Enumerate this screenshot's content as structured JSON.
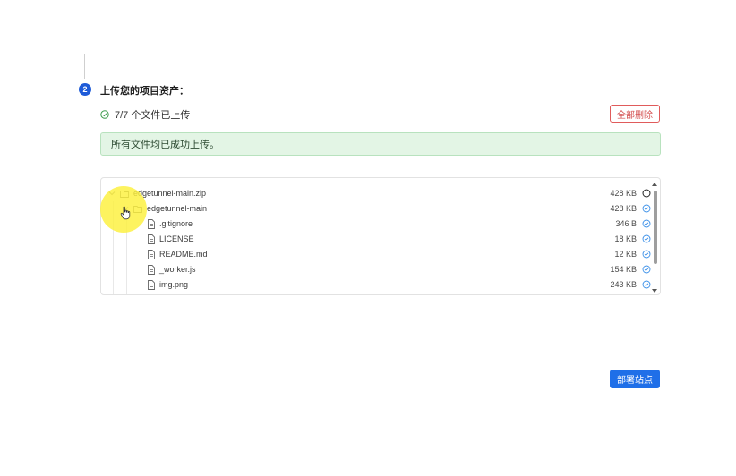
{
  "step": {
    "number": "2",
    "title": "上传您的项目资产："
  },
  "upload_status": {
    "text": "7/7 个文件已上传",
    "delete_all_label": "全部删除"
  },
  "success_banner": {
    "text": "所有文件均已成功上传。"
  },
  "file_tree": {
    "rows": [
      {
        "name": "edgetunnel-main.zip",
        "size": "428 KB",
        "type": "folder",
        "expanded": true,
        "status": "pending-circle"
      },
      {
        "name": "edgetunnel-main",
        "size": "428 KB",
        "type": "folder",
        "expanded": true,
        "status": "check-circle"
      },
      {
        "name": ".gitignore",
        "size": "346 B",
        "type": "file",
        "status": "check-circle"
      },
      {
        "name": "LICENSE",
        "size": "18 KB",
        "type": "file",
        "status": "check-circle"
      },
      {
        "name": "README.md",
        "size": "12 KB",
        "type": "file",
        "status": "check-circle"
      },
      {
        "name": "_worker.js",
        "size": "154 KB",
        "type": "file",
        "status": "check-circle"
      },
      {
        "name": "img.png",
        "size": "243 KB",
        "type": "file",
        "status": "check-circle"
      }
    ]
  },
  "deploy": {
    "label": "部署站点"
  },
  "colors": {
    "accent": "#1f6fe8",
    "success_bg": "#e3f5e5",
    "danger": "#d24a4a",
    "check_icon": "#3a8fe8"
  }
}
